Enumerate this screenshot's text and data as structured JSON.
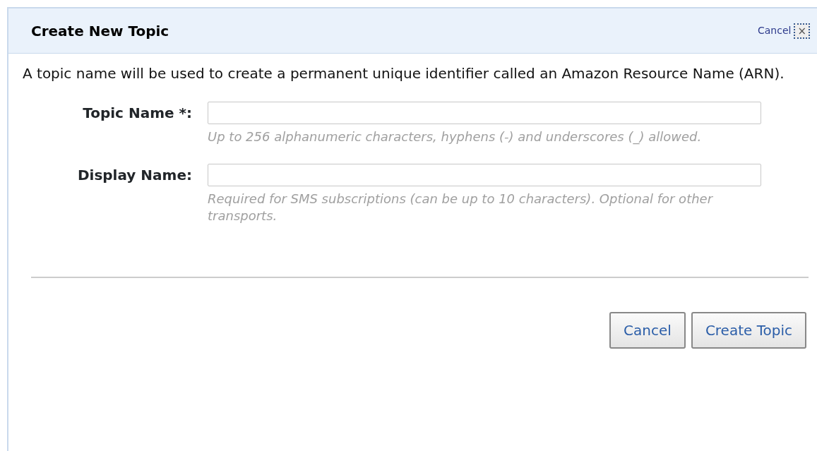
{
  "dialog": {
    "title": "Create New Topic",
    "close_link": "Cancel",
    "close_icon": "×"
  },
  "description": "A topic name will be used to create a permanent unique identifier called an Amazon Resource Name (ARN).",
  "fields": [
    {
      "label": "Topic Name *:",
      "hint": "Up to 256 alphanumeric characters, hyphens (-) and underscores (_) allowed."
    },
    {
      "label": "Display Name:",
      "hint": "Required for SMS subscriptions (can be up to 10 characters). Optional for other transports."
    }
  ],
  "buttons": [
    "Cancel",
    "Create Topic"
  ]
}
